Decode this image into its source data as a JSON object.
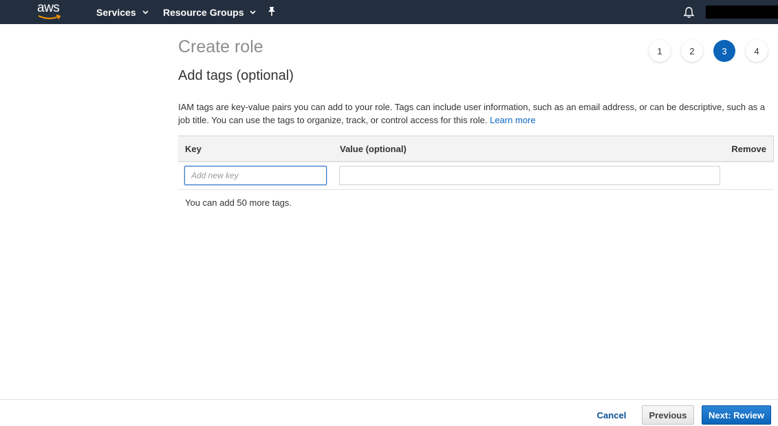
{
  "topnav": {
    "logo_text": "aws",
    "services_label": "Services",
    "resource_groups_label": "Resource Groups",
    "bg_color": "#232f3e",
    "icons": [
      "aws-logo",
      "chevron-down-icon",
      "pin-icon",
      "bell-icon"
    ]
  },
  "header": {
    "page_title": "Create role",
    "section_title": "Add tags (optional)"
  },
  "steps": {
    "items": [
      "1",
      "2",
      "3",
      "4"
    ],
    "active": "3",
    "active_color": "#0c64b8"
  },
  "description": {
    "text": "IAM tags are key-value pairs you can add to your role. Tags can include user information, such as an email address, or can be descriptive, such as a job title. You can use the tags to organize, track, or control access for this role.",
    "link_text": "Learn more"
  },
  "tags_table": {
    "columns": [
      "Key",
      "Value (optional)",
      "Remove"
    ],
    "key_placeholder": "Add new key",
    "key_value": "",
    "value_placeholder": "",
    "value_value": ""
  },
  "remaining_text": "You can add 50 more tags.",
  "footer": {
    "cancel_label": "Cancel",
    "previous_label": "Previous",
    "next_label": "Next: Review",
    "primary_color": "#0c64b8"
  }
}
